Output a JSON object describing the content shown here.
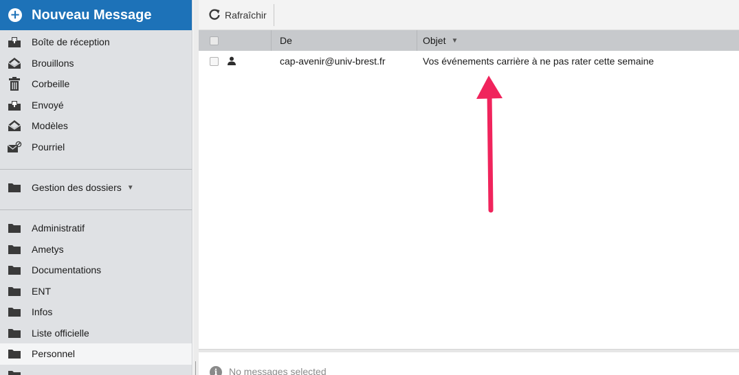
{
  "sidebar": {
    "new_message_label": "Nouveau Message",
    "mail_folders": [
      {
        "label": "Boîte de réception",
        "icon": "inbox-icon"
      },
      {
        "label": "Brouillons",
        "icon": "drafts-icon"
      },
      {
        "label": "Corbeille",
        "icon": "trash-icon"
      },
      {
        "label": "Envoyé",
        "icon": "sent-icon"
      },
      {
        "label": "Modèles",
        "icon": "templates-icon"
      },
      {
        "label": "Pourriel",
        "icon": "spam-icon"
      }
    ],
    "folder_management_label": "Gestion des dossiers",
    "custom_folders": [
      {
        "label": "Administratif",
        "icon": "folder-icon"
      },
      {
        "label": "Ametys",
        "icon": "folder-icon"
      },
      {
        "label": "Documentations",
        "icon": "folder-icon"
      },
      {
        "label": "ENT",
        "icon": "folder-icon"
      },
      {
        "label": "Infos",
        "icon": "folder-icon"
      },
      {
        "label": "Liste officielle",
        "icon": "folder-icon"
      },
      {
        "label": "Personnel",
        "icon": "folder-icon",
        "active": true
      }
    ]
  },
  "toolbar": {
    "refresh_label": "Rafraîchir"
  },
  "grid": {
    "columns": {
      "from": "De",
      "subject": "Objet"
    },
    "rows": [
      {
        "from": "cap-avenir@univ-brest.fr",
        "subject": "Vos événements carrière à ne pas rater cette semaine"
      }
    ]
  },
  "preview": {
    "empty_message": "No messages selected"
  },
  "colors": {
    "accent": "#1d72b8",
    "sidebar_bg": "#dfe1e4",
    "header_bg": "#c7c9cc",
    "annotation_arrow": "#f0245c"
  }
}
